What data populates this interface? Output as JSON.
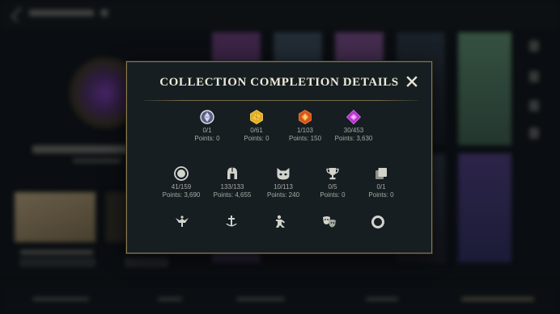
{
  "modal": {
    "title": "COLLECTION COMPLETION DETAILS",
    "close_label": "✕"
  },
  "gem_row": [
    {
      "icon": "crystal-orb-icon",
      "color": "#c9c3dd",
      "count": "0/1",
      "points": "Points: 0"
    },
    {
      "icon": "gold-gem-icon",
      "color": "#e8b12a",
      "count": "0/61",
      "points": "Points: 0"
    },
    {
      "icon": "orange-gem-icon",
      "color": "#e5661d",
      "count": "1/103",
      "points": "Points: 150"
    },
    {
      "icon": "purple-gem-icon",
      "color": "#c43ddc",
      "count": "30/453",
      "points": "Points: 3,630"
    }
  ],
  "category_row": [
    {
      "icon": "circle-icon",
      "count": "41/159",
      "points": "Points: 3,690"
    },
    {
      "icon": "helmet-icon",
      "count": "133/133",
      "points": "Points: 4,655"
    },
    {
      "icon": "cat-mask-icon",
      "count": "10/113",
      "points": "Points: 240"
    },
    {
      "icon": "trophy-icon",
      "count": "0/5",
      "points": "Points: 0"
    },
    {
      "icon": "cards-icon",
      "count": "0/1",
      "points": "Points: 0"
    }
  ],
  "bottom_icons": [
    "emote-icon",
    "ward-icon",
    "champion-pose-icon",
    "masks-icon",
    "ring-icon"
  ],
  "colors": {
    "frame": "#8c7a4e",
    "panel": "#161e22",
    "title": "#efe9d8",
    "text": "#a9aaa3",
    "icon": "#cfd0c8"
  }
}
